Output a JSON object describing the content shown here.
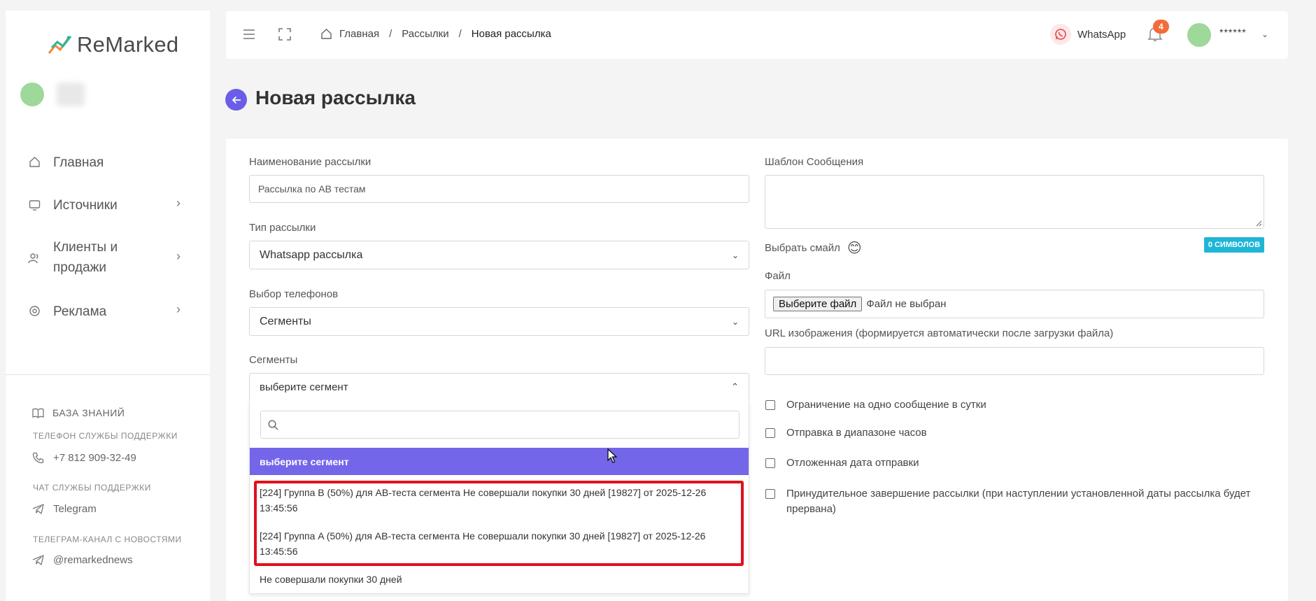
{
  "brand": {
    "name": "ReMarked"
  },
  "sidebar": {
    "nav": [
      {
        "label": "Главная",
        "icon": "home-icon"
      },
      {
        "label": "Источники",
        "icon": "monitor-icon"
      },
      {
        "label_line1": "Клиенты и",
        "label_line2": "продажи",
        "icon": "users-icon"
      },
      {
        "label": "Реклама",
        "icon": "target-icon"
      }
    ],
    "knowledge_base": "БАЗА ЗНАНИЙ",
    "phone_caption": "ТЕЛЕФОН СЛУЖБЫ ПОДДЕРЖКИ",
    "phone": "+7 812 909-32-49",
    "chat_caption": "ЧАТ СЛУЖБЫ ПОДДЕРЖКИ",
    "chat": "Telegram",
    "news_caption": "ТЕЛЕГРАМ-КАНАЛ С НОВОСТЯМИ",
    "news": "@remarkednews"
  },
  "topbar": {
    "breadcrumbs": [
      "Главная",
      "Рассылки",
      "Новая рассылка"
    ],
    "separator": "/",
    "whatsapp": "WhatsApp",
    "notifications_count": "4",
    "username": "******"
  },
  "page": {
    "title": "Новая рассылка"
  },
  "form": {
    "name_label": "Наименование рассылки",
    "name_value": "Рассылка по АВ тестам",
    "type_label": "Тип рассылки",
    "type_value": "Whatsapp рассылка",
    "phones_label": "Выбор телефонов",
    "phones_value": "Сегменты",
    "segments_label": "Сегменты",
    "segments_value": "выберите сегмент",
    "dropdown": {
      "highlighted": "выберите сегмент",
      "options": [
        {
          "line1": "[224] Группа B (50%) для AB-теста сегмента Не совершали покупки 30 дней [19827] от 2025-12-26",
          "line2": "13:45:56"
        },
        {
          "line1": "[224] Группа A (50%) для AB-теста сегмента Не совершали покупки 30 дней [19827] от 2025-12-26",
          "line2": "13:45:56"
        },
        {
          "line1": "Не совершали покупки 30 дней",
          "line2": ""
        }
      ]
    },
    "template_label": "Шаблон Сообщения",
    "emoji_label": "Выбрать смайл",
    "emoji": "😊",
    "char_counter": "0 СИМВОЛОВ",
    "file_label": "Файл",
    "file_button": "Выберите файл",
    "file_status": "Файл не выбран",
    "url_label": "URL изображения (формируется автоматически после загрузки файла)",
    "checkboxes": [
      {
        "label": "Ограничение на одно сообщение в сутки",
        "checked": false
      },
      {
        "label": "Отправка в диапазоне часов",
        "checked": false
      },
      {
        "label": "Отложенная дата отправки",
        "checked": false
      },
      {
        "label_line1": "Принудительное завершение рассылки (при наступлении установленной даты рассылка будет",
        "label_line2": "прервана)",
        "checked": false
      }
    ]
  },
  "colors": {
    "accent": "#6a5ee8",
    "highlight": "#7466e8",
    "badge": "#f26b3a",
    "counter": "#1fb6d6",
    "annotation": "#e0101e"
  }
}
